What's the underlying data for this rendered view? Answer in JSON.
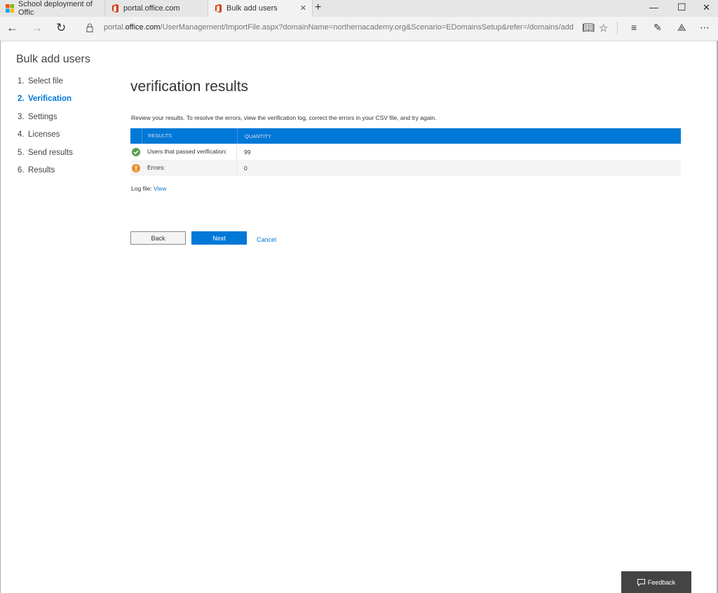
{
  "browser": {
    "tabs": [
      {
        "title": "School deployment of Offic",
        "icon": "microsoft-logo-icon"
      },
      {
        "title": "portal.office.com",
        "icon": "office-logo-icon"
      },
      {
        "title": "Bulk add users",
        "icon": "office-logo-icon",
        "active": true
      }
    ],
    "url_prefix": "portal.",
    "url_domain": "office.com",
    "url_path": "/UserManagement/ImportFile.aspx?domainName=northernacademy.org&Scenario=EDomainsSetup&refer=/domains/add"
  },
  "app": {
    "title": "Bulk add users",
    "steps": [
      {
        "num": "1.",
        "label": "Select file"
      },
      {
        "num": "2.",
        "label": "Verification",
        "active": true
      },
      {
        "num": "3.",
        "label": "Settings"
      },
      {
        "num": "4.",
        "label": "Licenses"
      },
      {
        "num": "5.",
        "label": "Send results"
      },
      {
        "num": "6.",
        "label": "Results"
      }
    ]
  },
  "main": {
    "heading": "verification results",
    "description": "Review your results. To resolve the errors, view the verification log, correct the errors in your CSV file, and try again.",
    "table": {
      "headers": [
        "RESULTS",
        "QUANTITY"
      ],
      "rows": [
        {
          "label": "Users that passed verification:",
          "value": "99",
          "status": "success"
        },
        {
          "label": "Errors:",
          "value": "0",
          "status": "warning"
        }
      ]
    },
    "log_label": "Log file:",
    "log_link": "View",
    "back": "Back",
    "next": "Next",
    "cancel": "Cancel"
  },
  "feedback": "Feedback",
  "colors": {
    "accent": "#0078d7",
    "success": "#5c9e53",
    "warning": "#e8912d"
  }
}
